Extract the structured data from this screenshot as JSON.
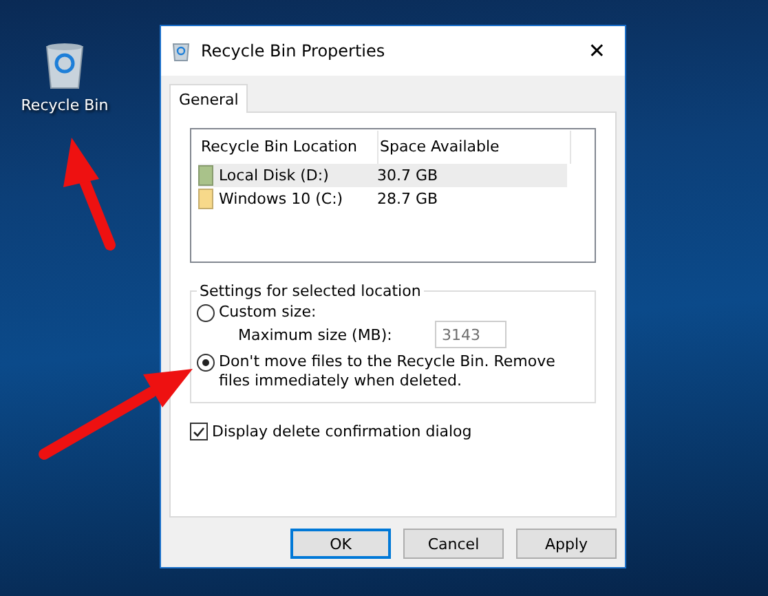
{
  "desktop_icon": {
    "label": "Recycle Bin"
  },
  "window": {
    "title": "Recycle Bin Properties",
    "close": "✕"
  },
  "tabs": [
    {
      "label": "General",
      "selected": true
    }
  ],
  "table": {
    "columns": [
      "Recycle Bin Location",
      "Space Available"
    ],
    "rows": [
      {
        "location": "Local Disk (D:)",
        "space": "30.7 GB",
        "color": "#a9c28a",
        "selected": true
      },
      {
        "location": "Windows 10 (C:)",
        "space": "28.7 GB",
        "color": "#f7d98a",
        "selected": false
      }
    ]
  },
  "settings": {
    "title": "Settings for selected location",
    "options": [
      {
        "label": "Custom size:",
        "selected": false
      },
      {
        "label": "Don't move files to the Recycle Bin. Remove files immediately when deleted.",
        "selected": true
      }
    ],
    "max_size": {
      "label": "Maximum size (MB):",
      "value": "3143",
      "disabled": true
    }
  },
  "confirm": {
    "label": "Display delete confirmation dialog",
    "checked": true
  },
  "buttons": [
    {
      "label": "OK",
      "default": true
    },
    {
      "label": "Cancel",
      "default": false
    },
    {
      "label": "Apply",
      "default": false
    }
  ]
}
